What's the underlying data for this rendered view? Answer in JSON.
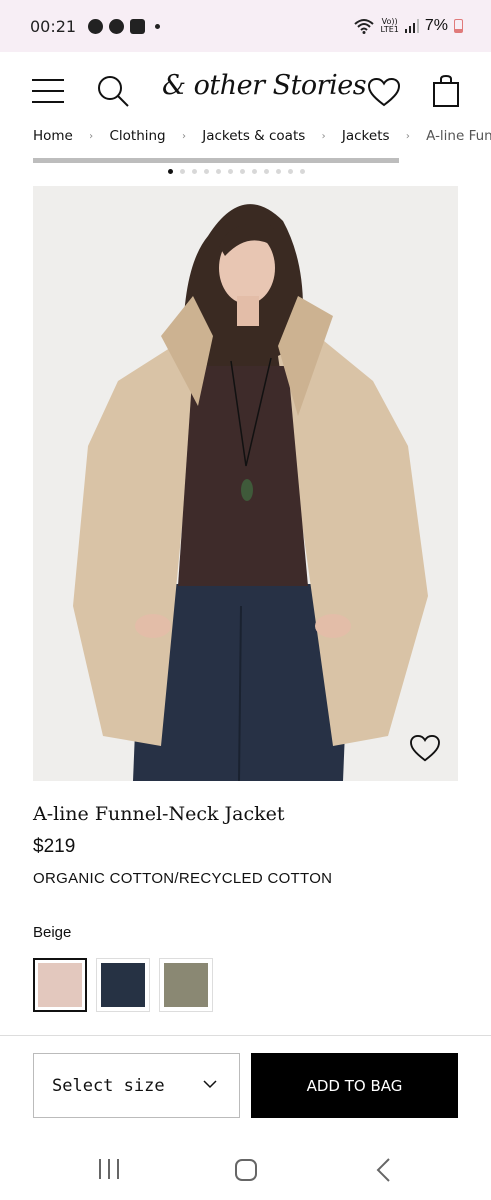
{
  "status_bar": {
    "time": "00:21",
    "network_label_top": "Vo))",
    "network_label_bottom": "LTE1",
    "battery": "7%",
    "icons": [
      "alert-icon",
      "messenger-icon",
      "checkbox-icon",
      "dot-icon",
      "wifi-icon",
      "signal-icon",
      "battery-icon"
    ]
  },
  "header": {
    "logo": "& other Stories",
    "icons": [
      "menu-icon",
      "search-icon",
      "heart-icon",
      "bag-icon"
    ]
  },
  "breadcrumb": [
    {
      "label": "Home"
    },
    {
      "label": "Clothing"
    },
    {
      "label": "Jackets & coats"
    },
    {
      "label": "Jackets"
    },
    {
      "label": "A-line Funnel-Neck Jacket"
    }
  ],
  "gallery": {
    "total_images": 12,
    "current_index": 1
  },
  "product": {
    "name": "A-line Funnel-Neck Jacket",
    "price": "$219",
    "material": "ORGANIC COTTON/RECYCLED COTTON",
    "selected_color": "Beige",
    "swatches": [
      {
        "color": "#e3c8be",
        "selected": true
      },
      {
        "color": "#263244",
        "selected": false
      },
      {
        "color": "#8a8873",
        "selected": false
      }
    ]
  },
  "actions": {
    "size_placeholder": "Select size",
    "add_to_bag": "ADD TO BAG"
  },
  "colors": {
    "status_bar_bg": "#f7eef5",
    "button_bg": "#000000",
    "jacket": "#d9c3a6",
    "top": "#3e2b2a",
    "jeans": "#273145"
  }
}
